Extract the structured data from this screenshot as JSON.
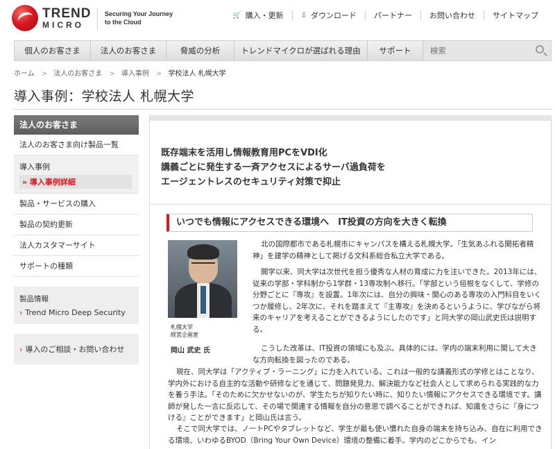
{
  "header": {
    "logo_line1": "TREND",
    "logo_line2": "MICRO",
    "tagline_1": "Securing Your Journey",
    "tagline_2": "to the Cloud",
    "util_links": [
      {
        "label": "購入・更新",
        "icon": "cart-icon",
        "glyph": "🛒"
      },
      {
        "label": "ダウンロード",
        "icon": "download-icon",
        "glyph": "⇩"
      },
      {
        "label": "パートナー"
      },
      {
        "label": "お問い合わせ"
      },
      {
        "label": "サイトマップ"
      }
    ]
  },
  "nav": {
    "items": [
      "個人のお客さま",
      "法人のお客さま",
      "脅威の分析",
      "トレンドマイクロが選ばれる理由",
      "サポート"
    ],
    "search_placeholder": "検索"
  },
  "breadcrumb": [
    "ホーム",
    "法人のお客さま",
    "導入事例",
    "学校法人 札幌大学"
  ],
  "page_title": "導入事例：学校法人 札幌大学",
  "sidebar": {
    "heading": "法人のお客さま",
    "item_products": "法人のお客さま向け製品一覧",
    "group_title": "導入事例",
    "group_sub": "» 導入事例詳細",
    "items": [
      "製品・サービスの購入",
      "製品の契約更新",
      "法人カスタマーサイト",
      "サポートの種類"
    ],
    "box_title": "製品情報",
    "box_link": "Trend Micro Deep Security",
    "contact_link": "導入のご相談・お問い合わせ"
  },
  "article": {
    "lead_1": "既存端末を活用し情報教育用PCをVDI化",
    "lead_2": "講義ごとに発生する一斉アクセスによるサーバ過負荷を",
    "lead_3": "エージェントレスのセキュリティ対策で抑止",
    "section_heading": "いつでも情報にアクセスできる環境へ　IT投資の方向を大きく転換",
    "caption_org_1": "札幌大学",
    "caption_org_2": "経営企画室",
    "caption_name": "岡山 武史 氏",
    "p1": "北の国際都市である札幌市にキャンパスを構える札幌大学。「生気あふれる開拓者精神」を建学の精神として掲げる文科系総合私立大学である。",
    "p2": "開学以来、同大学は次世代を担う優秀な人材の育成に力を注いできた。2013年には、従来の学部・学科制から1学群・13専攻制へ移行。「学部という垣根をなくして、学修の分野ごとに『専攻』を設置。1年次には、自分の興味・関心のある専攻の入門科目をいくつか履修し、2年次に、それを踏まえて『主専攻』を決めるというように、学びながら将来のキャリアを考えることができるようにしたのです」と同大学の岡山武史氏は説明する。",
    "p3": "こうした改革は、IT投資の領域にも及ぶ。具体的には、学内の端末利用に関して大きな方向転換を図ったのである。",
    "p4": "現在、同大学は「アクティブ・ラーニング」に力を入れている。これは一般的な講義形式の学修とはことなり、学内外における自主的な活動や研修などを通じて、問題発見力、解決能力など社会人として求められる実践的な力を養う手法。「そのために欠かせないのが、学生たちが知りたい時に、知りたい情報にアクセスできる環境です。講師が発した一言に反応して、その場で関連する情報を自分の意思で調べることができれば、知識をさらに『身につける』ことができます」と岡山氏は言う。",
    "p5": "そこで同大学では、ノートPCやタブレットなど、学生が最も使い慣れた自身の端末を持ち込み、自在に利用できる環境、いわゆるBYOD（Bring Your Own Device）環境の整備に着手。学内のどこからでも、イン"
  },
  "colors": {
    "brand_red": "#d71920",
    "nav_bg": "#e4e4e4",
    "sidebar_head": "#666666"
  }
}
